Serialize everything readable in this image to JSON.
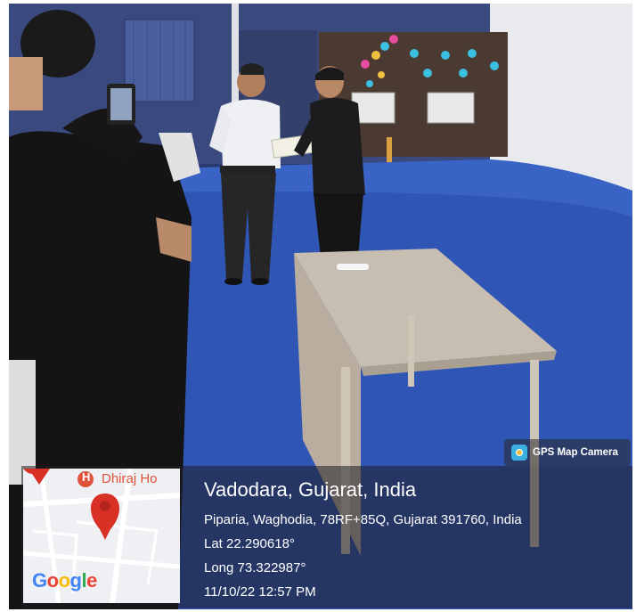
{
  "badge": {
    "label": "GPS Map Camera",
    "icon": "camera-icon"
  },
  "map": {
    "poi_letter": "H",
    "poi_label": "Dhiraj Ho",
    "logo": {
      "G": "#4285F4",
      "o1": "#EA4335",
      "o2": "#FBBC05",
      "g": "#4285F4",
      "l": "#34A853",
      "e": "#EA4335"
    },
    "pin_color": "#d93025"
  },
  "info": {
    "location": "Vadodara, Gujarat, India",
    "address": "Piparia, Waghodia, 78RF+85Q, Gujarat 391760, India",
    "lat": "Lat 22.290618°",
    "long": "Long 73.322987°",
    "datetime": "11/10/22 12:57 PM"
  },
  "logo_text": [
    "G",
    "o",
    "o",
    "g",
    "l",
    "e"
  ]
}
